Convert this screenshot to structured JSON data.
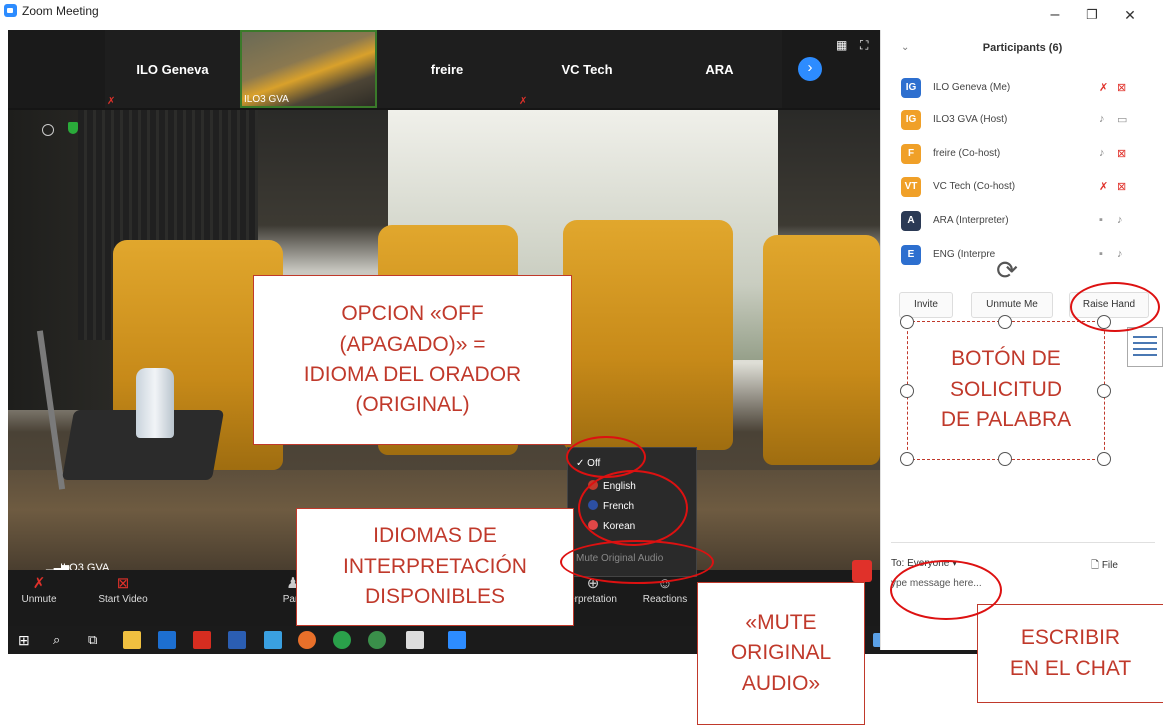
{
  "window": {
    "title": "Zoom Meeting",
    "controls": [
      "–",
      "❐",
      "✕"
    ]
  },
  "thumbnails": [
    {
      "name": "ILO Geneva",
      "muted": true
    },
    {
      "name": "ILO3 GVA",
      "label": "ILO3 GVA",
      "video": true
    },
    {
      "name": "freire",
      "muted": false
    },
    {
      "name": "VC Tech",
      "muted": true
    },
    {
      "name": "ARA",
      "muted": false
    }
  ],
  "video": {
    "speaker_label": "ILO3 GVA"
  },
  "toolbar": {
    "unmute": "Unmute",
    "start_video": "Start Video",
    "participants": "Parti",
    "interpretation": "erpretation",
    "reactions": "Reactions"
  },
  "language_menu": {
    "off": "Off",
    "options": [
      "English",
      "French",
      "Korean"
    ],
    "mute_original": "Mute Original Audio"
  },
  "participants_panel": {
    "title": "Participants (6)",
    "participants": [
      {
        "initials": "IG",
        "name": "ILO Geneva (Me)",
        "color": "#2d6fcf",
        "mic": "muted",
        "cam": "off"
      },
      {
        "initials": "IG",
        "name": "ILO3 GVA (Host)",
        "color": "#f0a028",
        "mic": "on",
        "cam": "on"
      },
      {
        "initials": "F",
        "name": "freire (Co-host)",
        "color": "#f0a028",
        "mic": "on",
        "cam": "off"
      },
      {
        "initials": "VT",
        "name": "VC Tech (Co-host)",
        "color": "#f0a028",
        "mic": "muted",
        "cam": "off"
      },
      {
        "initials": "A",
        "name": "ARA (Interpreter)",
        "color": "#2b3a55",
        "mic": "on",
        "cam": ""
      },
      {
        "initials": "E",
        "name": "ENG (Interpre",
        "color": "#2d6fcf",
        "mic": "on",
        "cam": ""
      }
    ],
    "buttons": {
      "invite": "Invite",
      "unmute_me": "Unmute Me",
      "raise_hand": "Raise Hand"
    }
  },
  "chat": {
    "to_label": "To:",
    "to_value": "Everyone ▾",
    "file": "File",
    "placeholder": "ype message here..."
  },
  "annotations": {
    "off_option": "OPCION «OFF\n(APAGADO)» =\nIDIOMA DEL ORADOR\n(ORIGINAL)",
    "languages": "IDIOMAS DE\nINTERPRETACIÓN\nDISPONIBLES",
    "mute_original": "«MUTE\nORIGINAL\nAUDIO»",
    "raise_hand": "BOTÓN DE\nSOLICITUD\nDE PALABRA",
    "chat": "ESCRIBIR\nEN EL CHAT"
  },
  "colors": {
    "accent": "#2d8cff",
    "annotation_red": "#c0392b",
    "muted_red": "#e0312a"
  }
}
